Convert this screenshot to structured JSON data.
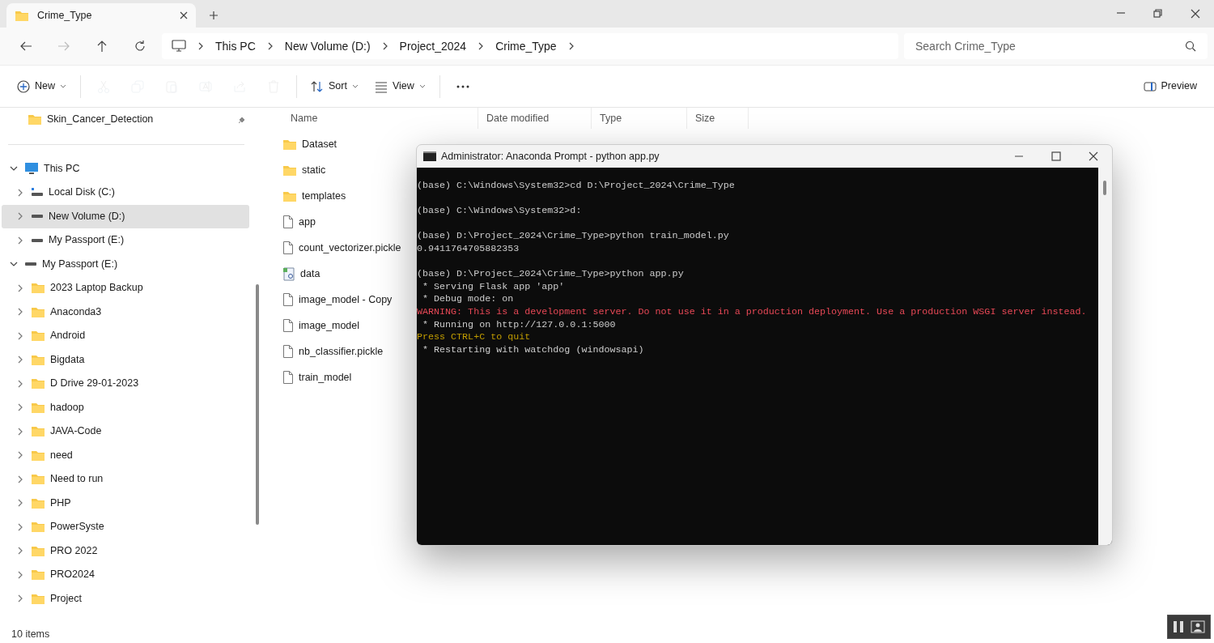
{
  "tab": {
    "title": "Crime_Type"
  },
  "breadcrumb": [
    "This PC",
    "New Volume (D:)",
    "Project_2024",
    "Crime_Type"
  ],
  "search": {
    "placeholder": "Search Crime_Type"
  },
  "toolbar": [
    {
      "kind": "new",
      "label": "New",
      "disabled": false
    },
    {
      "kind": "cut",
      "disabled": true
    },
    {
      "kind": "copy",
      "disabled": true
    },
    {
      "kind": "paste",
      "disabled": true
    },
    {
      "kind": "rename",
      "disabled": true
    },
    {
      "kind": "share",
      "disabled": true
    },
    {
      "kind": "delete",
      "disabled": true
    },
    {
      "kind": "sort",
      "label": "Sort",
      "disabled": false
    },
    {
      "kind": "view",
      "label": "View",
      "disabled": false
    },
    {
      "kind": "more",
      "disabled": false
    }
  ],
  "preview": {
    "label": "Preview"
  },
  "pinned": [
    {
      "label": "Skin_Cancer_Detection",
      "selected": false
    }
  ],
  "tree": [
    {
      "label": "This PC",
      "kind": "pc",
      "expanded": true,
      "selected": false,
      "children": [
        {
          "label": "Local Disk (C:)",
          "kind": "os-drive",
          "expanded": false,
          "selected": false
        },
        {
          "label": "New Volume (D:)",
          "kind": "drive",
          "expanded": false,
          "selected": true
        },
        {
          "label": "My Passport (E:)",
          "kind": "drive",
          "expanded": false,
          "selected": false
        }
      ]
    },
    {
      "label": "My Passport (E:)",
      "kind": "drive",
      "expanded": true,
      "selected": false,
      "children": [
        {
          "label": "2023 Laptop Backup",
          "kind": "folder",
          "expanded": false,
          "selected": false
        },
        {
          "label": "Anaconda3",
          "kind": "folder",
          "expanded": false,
          "selected": false
        },
        {
          "label": "Android",
          "kind": "folder",
          "expanded": false,
          "selected": false
        },
        {
          "label": "Bigdata",
          "kind": "folder",
          "expanded": false,
          "selected": false
        },
        {
          "label": "D Drive 29-01-2023",
          "kind": "folder",
          "expanded": false,
          "selected": false
        },
        {
          "label": "hadoop",
          "kind": "folder",
          "expanded": false,
          "selected": false
        },
        {
          "label": "JAVA-Code",
          "kind": "folder",
          "expanded": false,
          "selected": false
        },
        {
          "label": "need",
          "kind": "folder",
          "expanded": false,
          "selected": false
        },
        {
          "label": "Need to run",
          "kind": "folder",
          "expanded": false,
          "selected": false
        },
        {
          "label": "PHP",
          "kind": "folder",
          "expanded": false,
          "selected": false
        },
        {
          "label": "PowerSyste",
          "kind": "folder",
          "expanded": false,
          "selected": false
        },
        {
          "label": "PRO 2022",
          "kind": "folder",
          "expanded": false,
          "selected": false
        },
        {
          "label": "PRO2024",
          "kind": "folder",
          "expanded": false,
          "selected": false
        },
        {
          "label": "Project",
          "kind": "folder",
          "expanded": false,
          "selected": false
        }
      ]
    }
  ],
  "columns": [
    {
      "label": "Name"
    },
    {
      "label": "Date modified"
    },
    {
      "label": "Type"
    },
    {
      "label": "Size"
    }
  ],
  "files": [
    {
      "name": "Dataset",
      "kind": "folder"
    },
    {
      "name": "static",
      "kind": "folder"
    },
    {
      "name": "templates",
      "kind": "folder"
    },
    {
      "name": "app",
      "kind": "file"
    },
    {
      "name": "count_vectorizer.pickle",
      "kind": "file"
    },
    {
      "name": "data",
      "kind": "text-doc"
    },
    {
      "name": "image_model - Copy",
      "kind": "file"
    },
    {
      "name": "image_model",
      "kind": "file"
    },
    {
      "name": "nb_classifier.pickle",
      "kind": "file"
    },
    {
      "name": "train_model",
      "kind": "file"
    }
  ],
  "status_bar": "10 items",
  "terminal": {
    "title": "Administrator: Anaconda Prompt - python  app.py",
    "lines": [
      {
        "kind": "normal",
        "text": "(base) C:\\Windows\\System32>cd D:\\Project_2024\\Crime_Type"
      },
      {
        "kind": "blank"
      },
      {
        "kind": "normal",
        "text": "(base) C:\\Windows\\System32>d:"
      },
      {
        "kind": "blank"
      },
      {
        "kind": "normal",
        "text": "(base) D:\\Project_2024\\Crime_Type>python train_model.py"
      },
      {
        "kind": "normal",
        "text": "0.9411764705882353"
      },
      {
        "kind": "blank"
      },
      {
        "kind": "normal",
        "text": "(base) D:\\Project_2024\\Crime_Type>python app.py"
      },
      {
        "kind": "normal",
        "text": " * Serving Flask app 'app'"
      },
      {
        "kind": "normal",
        "text": " * Debug mode: on"
      },
      {
        "kind": "warning",
        "text": "WARNING: This is a development server. Do not use it in a production deployment. Use a production WSGI server instead."
      },
      {
        "kind": "normal",
        "text": " * Running on http://127.0.0.1:5000"
      },
      {
        "kind": "notice",
        "text": "Press CTRL+C to quit"
      },
      {
        "kind": "normal",
        "text": " * Restarting with watchdog (windowsapi)"
      }
    ]
  }
}
